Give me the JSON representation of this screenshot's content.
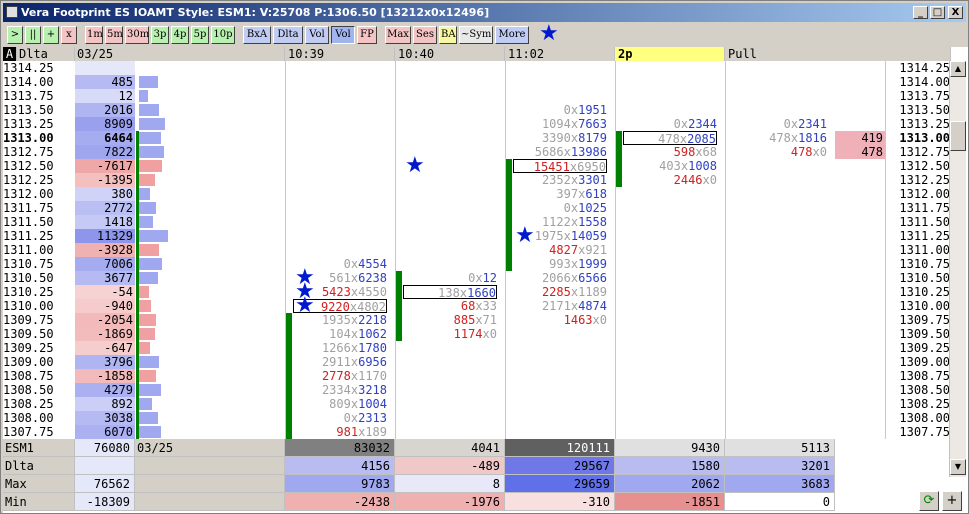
{
  "title": "Vera Footprint ES IOAMT Style: ESM1: V:25708 P:1306.50 [13212x0x12496]",
  "window_buttons": {
    "minimize": "_",
    "maximize": "□",
    "close": "X"
  },
  "toolbar": [
    {
      "label": ">",
      "style": "green"
    },
    {
      "label": "||",
      "style": "green"
    },
    {
      "label": "+",
      "style": "green"
    },
    {
      "label": "x",
      "style": "pink"
    },
    {
      "label": "1m",
      "style": "pink"
    },
    {
      "label": "5m",
      "style": "pink"
    },
    {
      "label": "30m",
      "style": "pink"
    },
    {
      "label": "3p",
      "style": "green"
    },
    {
      "label": "4p",
      "style": "green"
    },
    {
      "label": "5p",
      "style": "green"
    },
    {
      "label": "10p",
      "style": "green"
    },
    {
      "label": "BxA",
      "style": "blue"
    },
    {
      "label": "Dlta",
      "style": "blue"
    },
    {
      "label": "Vol",
      "style": "blue"
    },
    {
      "label": "Vol",
      "style": "sel"
    },
    {
      "label": "FP",
      "style": "pink"
    },
    {
      "label": "Max",
      "style": "pink"
    },
    {
      "label": "Ses",
      "style": "pink"
    },
    {
      "label": "BA",
      "style": "yellow"
    },
    {
      "label": "~Sym",
      "style": "gray"
    },
    {
      "label": "More",
      "style": "blue"
    }
  ],
  "star_icon": "★",
  "headers": {
    "corner": "A",
    "dlta": "Dlta",
    "date": "03/25",
    "c1": "10:39",
    "c2": "10:40",
    "c3": "11:02",
    "c4": "2p",
    "c5": "Pull"
  },
  "prices": [
    "1314.25",
    "1314.00",
    "1313.75",
    "1313.50",
    "1313.25",
    "1313.00",
    "1312.75",
    "1312.50",
    "1312.25",
    "1312.00",
    "1311.75",
    "1311.50",
    "1311.25",
    "1311.00",
    "1310.75",
    "1310.50",
    "1310.25",
    "1310.00",
    "1309.75",
    "1309.50",
    "1309.25",
    "1309.00",
    "1308.75",
    "1308.50",
    "1308.25",
    "1308.00",
    "1307.75"
  ],
  "delta": [
    "",
    "485",
    "12",
    "2016",
    "8909",
    "6464",
    "7822",
    "-7617",
    "-1395",
    "380",
    "2772",
    "1418",
    "11329",
    "-3928",
    "7006",
    "3677",
    "-54",
    "-940",
    "-2054",
    "-1869",
    "-647",
    "3796",
    "-1858",
    "4279",
    "892",
    "3038",
    "6070"
  ],
  "delta_level": [
    0,
    0.35,
    0.02,
    0.4,
    0.6,
    0.48,
    0.55,
    0.5,
    0.25,
    0.1,
    0.3,
    0.2,
    0.7,
    0.4,
    0.5,
    0.35,
    0.05,
    0.12,
    0.3,
    0.28,
    0.1,
    0.4,
    0.3,
    0.45,
    0.15,
    0.35,
    0.45
  ],
  "col1": [
    "",
    "",
    "",
    "",
    "",
    "",
    "",
    "",
    "",
    "",
    "",
    "",
    "",
    "",
    "0x4554",
    "561x6238",
    "5423x4550",
    "9220x4802",
    "1935x2218",
    "104x1062",
    "1266x1780",
    "2911x6956",
    "2778x1170",
    "2334x3218",
    "809x1004",
    "0x2313",
    "981x189"
  ],
  "col2": [
    "",
    "",
    "",
    "",
    "",
    "",
    "",
    "",
    "",
    "",
    "",
    "",
    "",
    "",
    "",
    "0x12",
    "138x1660",
    "68x33",
    "885x71",
    "1174x0",
    "",
    "",
    "",
    "",
    "",
    "",
    ""
  ],
  "col3": [
    "",
    "",
    "",
    "0x1951",
    "1094x7663",
    "3390x8179",
    "5686x13986",
    "15451x6950",
    "2352x3301",
    "397x618",
    "0x1025",
    "1122x1558",
    "1975x14059",
    "4827x921",
    "993x1999",
    "2066x6566",
    "2285x1189",
    "2171x4874",
    "1463x0",
    "",
    "",
    "",
    "",
    "",
    "",
    "",
    ""
  ],
  "col4": [
    "",
    "",
    "",
    "",
    "0x2344",
    "478x2085",
    "598x68",
    "403x1008",
    "2446x0",
    "",
    "",
    "",
    "",
    "",
    "",
    "",
    "",
    "",
    "",
    "",
    "",
    "",
    "",
    "",
    "",
    "",
    ""
  ],
  "col5": [
    "",
    "",
    "",
    "",
    "0x2341",
    "478x1816",
    "478x0",
    "",
    "",
    "",
    "",
    "",
    "",
    "",
    "",
    "",
    "",
    "",
    "",
    "",
    "",
    "",
    "",
    "",
    "",
    "",
    ""
  ],
  "pull": [
    "",
    "",
    "",
    "",
    "",
    "419",
    "478",
    "",
    "",
    "",
    "",
    "",
    "",
    "",
    "",
    "",
    "",
    "",
    "",
    "",
    "",
    "",
    "",
    "",
    "",
    "",
    ""
  ],
  "footer": {
    "rows": [
      {
        "label": "ESM1",
        "v0": "76080",
        "v0b": "03/25",
        "c1": "83032",
        "c2": "4041",
        "c3": "120111",
        "c4": "9430",
        "c5": "5113"
      },
      {
        "label": "Dlta",
        "v0": "",
        "v0b": "",
        "c1": "4156",
        "c2": "-489",
        "c3": "29567",
        "c4": "1580",
        "c5": "3201"
      },
      {
        "label": "Max",
        "v0": "76562",
        "v0b": "",
        "c1": "9783",
        "c2": "8",
        "c3": "29659",
        "c4": "2062",
        "c5": "3683"
      },
      {
        "label": "Min",
        "v0": "-18309",
        "v0b": "",
        "c1": "-2438",
        "c2": "-1976",
        "c3": "-310",
        "c4": "-1851",
        "c5": "0"
      }
    ]
  },
  "colors": {
    "blue_text": "#3040c0",
    "red_text": "#d02020",
    "gray_text": "#a0a0a0",
    "buy_bar": "#a0a8f0",
    "sell_bar": "#f0a0a0",
    "green_bar": "#008000"
  }
}
